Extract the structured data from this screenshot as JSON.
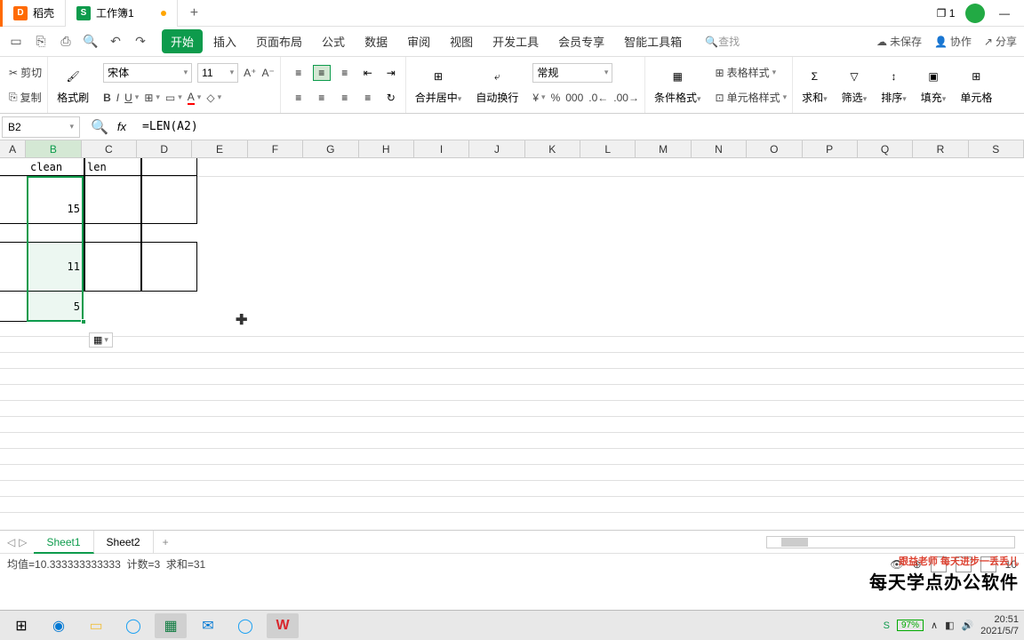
{
  "tabs": {
    "docer": "稻壳",
    "workbook": "工作簿1"
  },
  "menu": {
    "start": "开始",
    "insert": "插入",
    "layout": "页面布局",
    "formula": "公式",
    "data": "数据",
    "review": "审阅",
    "view": "视图",
    "dev": "开发工具",
    "member": "会员专享",
    "smart": "智能工具箱",
    "search_ph": "查找"
  },
  "topright": {
    "unsaved": "未保存",
    "collab": "协作",
    "share": "分享"
  },
  "ribbon": {
    "cut": "剪切",
    "copy": "复制",
    "brush": "格式刷",
    "font": "宋体",
    "size": "11",
    "merge": "合并居中",
    "wrap": "自动换行",
    "normal": "常规",
    "cond": "条件格式",
    "tablestyle": "表格样式",
    "cellstyle": "单元格样式",
    "sum": "求和",
    "filter": "筛选",
    "sort": "排序",
    "fill": "填充",
    "cellfmt": "单元格"
  },
  "formula_bar": {
    "cell_ref": "B2",
    "formula": "=LEN(A2)"
  },
  "columns": [
    "A",
    "B",
    "C",
    "D",
    "E",
    "F",
    "G",
    "H",
    "I",
    "J",
    "K",
    "L",
    "M",
    "N",
    "O",
    "P",
    "Q",
    "R",
    "S"
  ],
  "cells": {
    "B1": "clean",
    "C1": "len",
    "B2": "15",
    "B3": "11",
    "B4": "5"
  },
  "autofill_label": "⬚",
  "sheets": {
    "s1": "Sheet1",
    "s2": "Sheet2"
  },
  "status": {
    "avg_label": "均值=",
    "avg": "10.333333333333",
    "count_label": "计数=",
    "count": "3",
    "sum_label": "求和=",
    "sum": "31",
    "zoom": "10"
  },
  "watermark": {
    "top": "跟益老师  每天进步一丢丢儿",
    "main": "每天学点办公软件"
  },
  "tray": {
    "battery": "97%",
    "time": "20:51",
    "date": "2021/5/7"
  }
}
